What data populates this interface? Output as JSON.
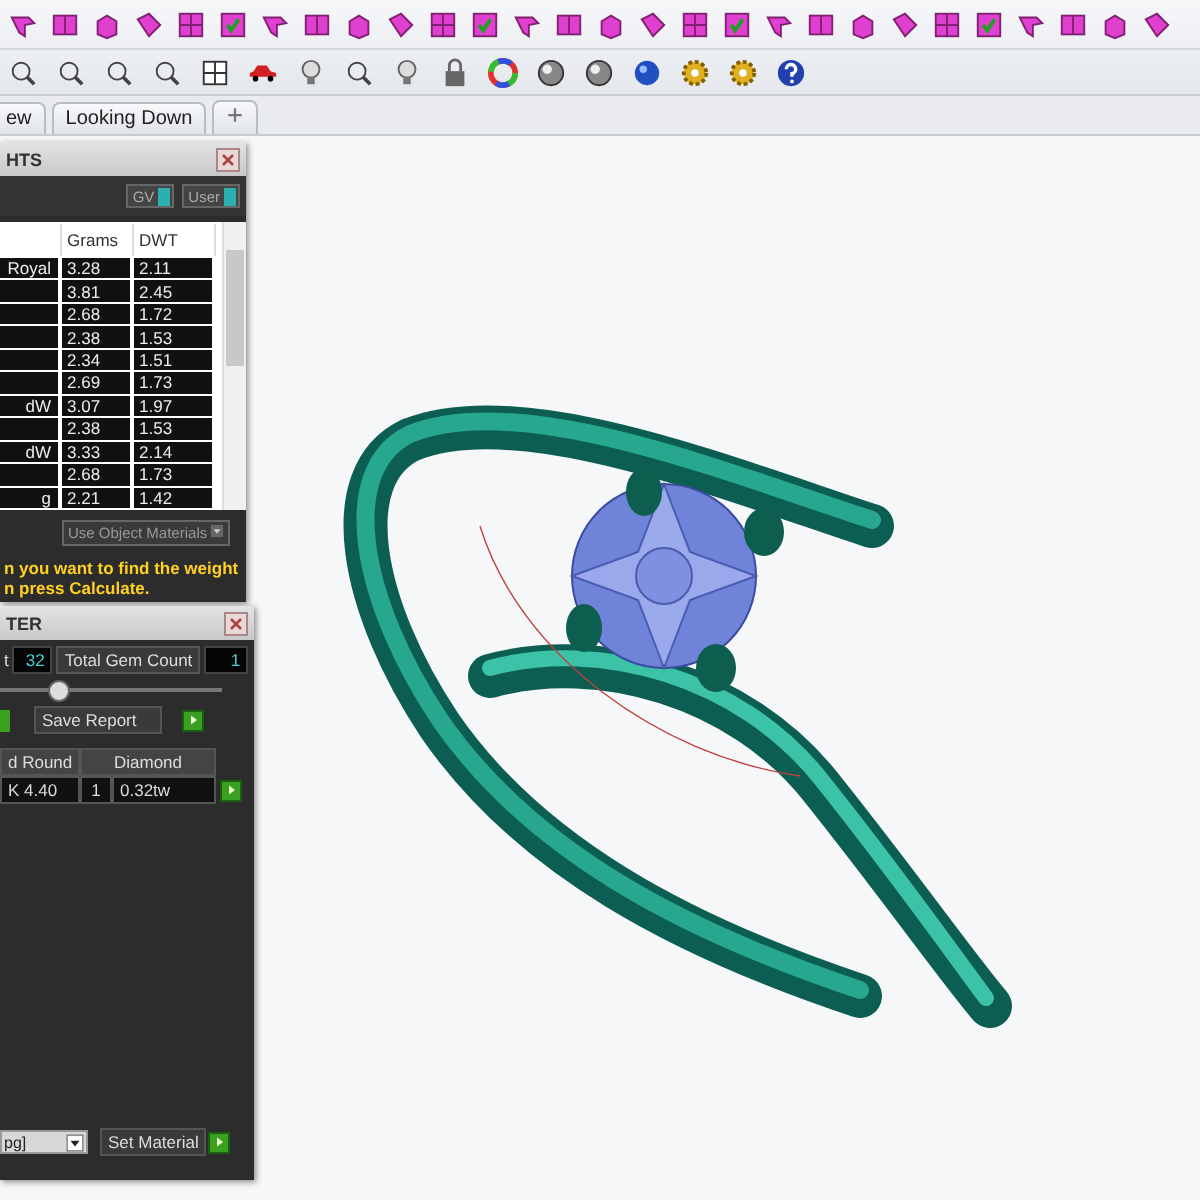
{
  "viewport_tabs": [
    {
      "label": "ew"
    },
    {
      "label": "Looking Down"
    }
  ],
  "weights_panel": {
    "title": "HTS",
    "toggles": [
      "GV",
      "User"
    ],
    "table": {
      "columns": [
        "Grams",
        "DWT"
      ],
      "rows": [
        {
          "name": "Royal",
          "grams": "3.28",
          "dwt": "2.11"
        },
        {
          "grams": "3.81",
          "dwt": "2.45"
        },
        {
          "grams": "2.68",
          "dwt": "1.72"
        },
        {
          "grams": "2.38",
          "dwt": "1.53"
        },
        {
          "grams": "2.34",
          "dwt": "1.51"
        },
        {
          "grams": "2.69",
          "dwt": "1.73"
        },
        {
          "name": "dW",
          "grams": "3.07",
          "dwt": "1.97"
        },
        {
          "grams": "2.38",
          "dwt": "1.53"
        },
        {
          "name": "dW",
          "grams": "3.33",
          "dwt": "2.14"
        },
        {
          "grams": "2.68",
          "dwt": "1.73"
        },
        {
          "name": "g",
          "grams": "2.21",
          "dwt": "1.42"
        }
      ]
    },
    "material_dropdown": "Use Object Materials",
    "message": [
      "n you want to find the weight",
      "n press Calculate."
    ]
  },
  "gem_panel": {
    "title": "TER",
    "count_label": "t",
    "count_value": "32",
    "total_label": "Total Gem Count",
    "total_value": "1",
    "slider": {
      "level": 0.25
    },
    "save_button": "Save Report",
    "gems": {
      "shape_heading": "d Round",
      "material_heading": "Diamond",
      "entries": [
        {
          "shape": "K 4.40",
          "count": "1",
          "weight": "0.32tw"
        }
      ]
    },
    "material_select": "pg]",
    "set_material_button": "Set Material"
  }
}
